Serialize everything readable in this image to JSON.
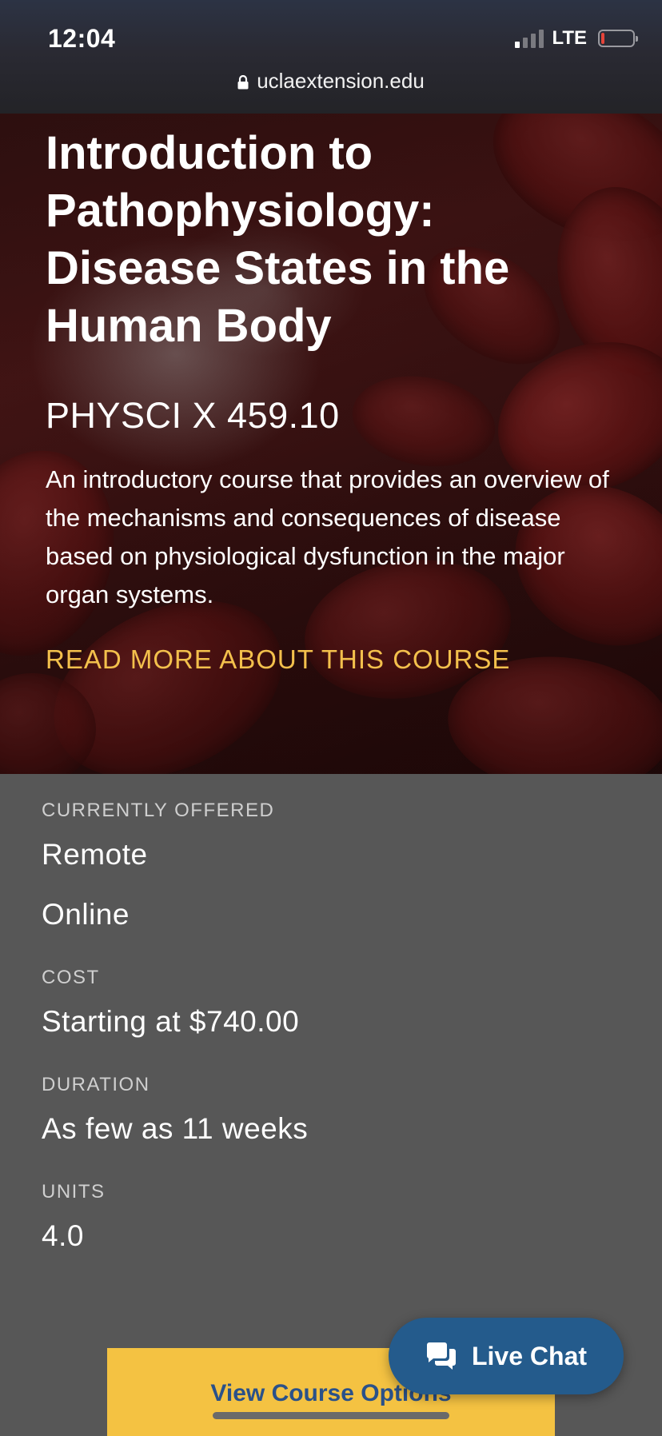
{
  "status_bar": {
    "time": "12:04",
    "network": "LTE",
    "url": "uclaextension.edu",
    "signal_bars_active": 1,
    "signal_bars_total": 4,
    "battery_level": 0.1
  },
  "course": {
    "title": "Introduction to Pathophysiology: Disease States in the Human Body",
    "code": "PHYSCI X 459.10",
    "description": "An introductory course that provides an overview of the mechanisms and consequences of disease based on physiological dysfunction in the major organ systems.",
    "read_more_label": "READ MORE ABOUT THIS COURSE"
  },
  "details": {
    "offered_label": "CURRENTLY OFFERED",
    "offered_values": [
      "Remote",
      "Online"
    ],
    "cost_label": "COST",
    "cost_value": "Starting at $740.00",
    "duration_label": "DURATION",
    "duration_value": "As few as 11 weeks",
    "units_label": "UNITS",
    "units_value": "4.0"
  },
  "actions": {
    "view_options_label": "View Course Options",
    "live_chat_label": "Live Chat"
  },
  "colors": {
    "accent_gold": "#f3c04c",
    "button_yellow": "#f4c242",
    "link_blue": "#2a5189",
    "chat_blue": "#245b8c",
    "panel_gray": "#575757"
  },
  "icons": {
    "lock": "lock-icon",
    "chat": "chat-bubble-icon",
    "signal": "signal-icon",
    "battery": "battery-icon"
  }
}
